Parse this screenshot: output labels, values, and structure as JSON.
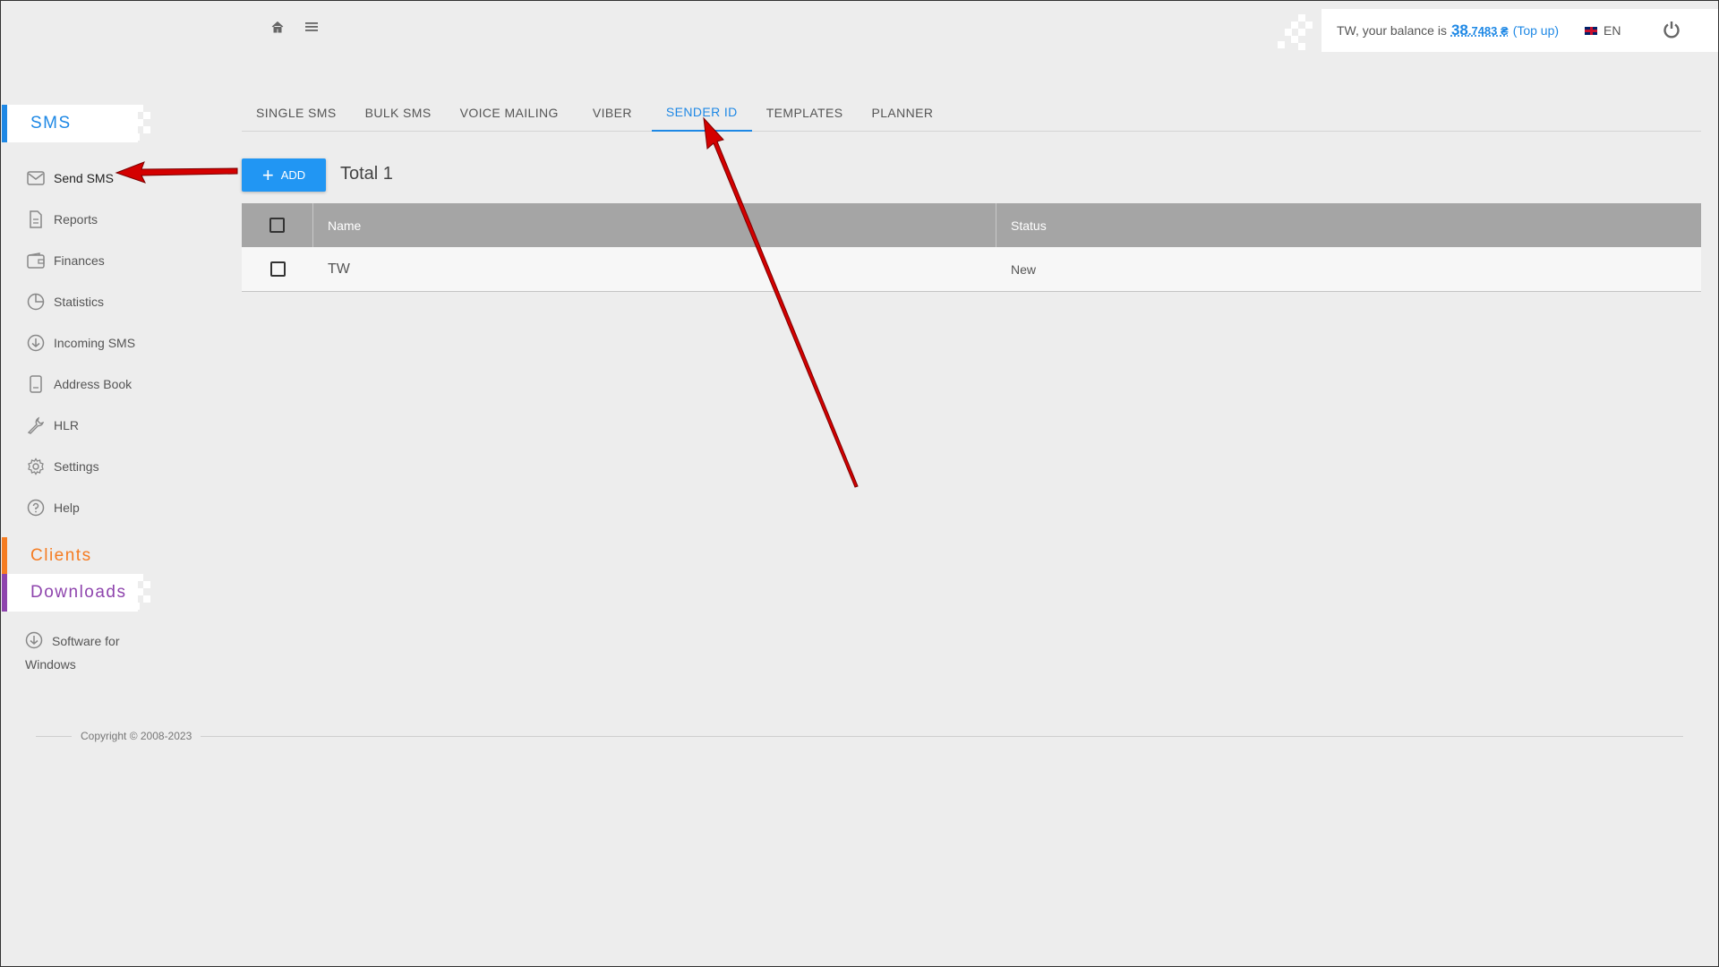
{
  "header": {
    "home_icon": "home-icon",
    "menu_icon": "hamburger-menu-icon",
    "balance_prefix": "TW, your balance is",
    "balance_int": "38",
    "balance_dec": ".7483 ₴",
    "topup_label": "(Top up)",
    "language": "EN",
    "power_icon": "power-icon"
  },
  "sidebar": {
    "sms_section": "SMS",
    "items": [
      {
        "label": "Send SMS",
        "icon": "envelope-icon"
      },
      {
        "label": "Reports",
        "icon": "document-icon"
      },
      {
        "label": "Finances",
        "icon": "wallet-icon"
      },
      {
        "label": "Statistics",
        "icon": "pie-chart-icon"
      },
      {
        "label": "Incoming SMS",
        "icon": "download-circle-icon"
      },
      {
        "label": "Address Book",
        "icon": "address-book-icon"
      },
      {
        "label": "HLR",
        "icon": "wrench-icon"
      },
      {
        "label": "Settings",
        "icon": "gear-icon"
      },
      {
        "label": "Help",
        "icon": "help-circle-icon"
      }
    ],
    "clients_section": "Clients",
    "downloads_section": "Downloads",
    "software_line1": "Software for",
    "software_line2": "Windows"
  },
  "tabs": [
    "SINGLE SMS",
    "BULK SMS",
    "VOICE MAILING",
    "VIBER",
    "SENDER ID",
    "TEMPLATES",
    "PLANNER"
  ],
  "active_tab": "SENDER ID",
  "toolbar": {
    "add_label": "ADD",
    "total_label": "Total 1"
  },
  "table": {
    "headers": {
      "name": "Name",
      "status": "Status"
    },
    "rows": [
      {
        "name": "TW",
        "status": "New"
      }
    ]
  },
  "footer": {
    "copyright": "Copyright © 2008-2023"
  },
  "colors": {
    "accent": "#1e88e5",
    "clients": "#f57c22",
    "downloads": "#8e44ad",
    "annotation_arrow": "#d40000"
  }
}
